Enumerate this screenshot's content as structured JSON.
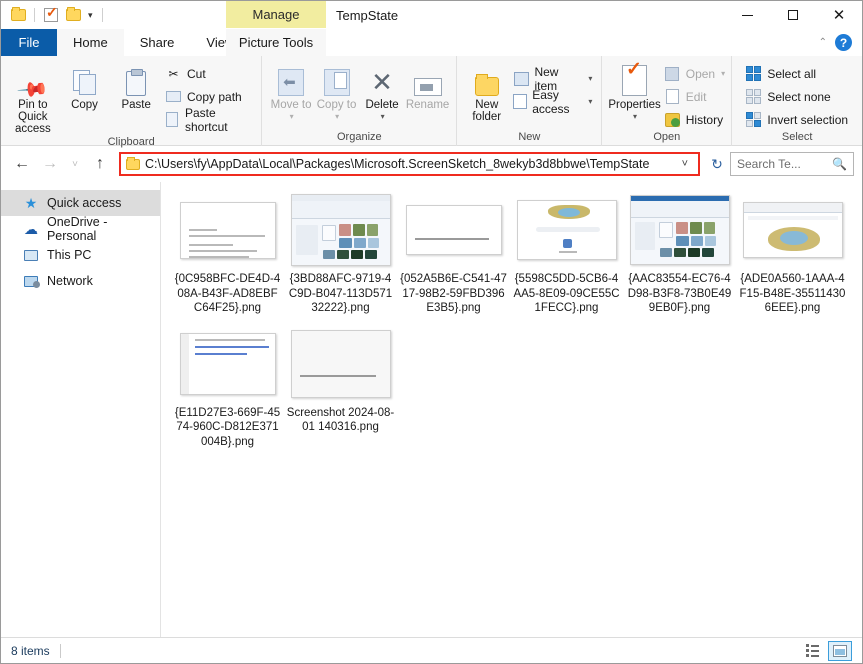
{
  "window": {
    "title": "TempState",
    "quick_access_toolbar": [
      {
        "name": "folder-properties",
        "icon": "folder-icon"
      },
      {
        "name": "checkbox-toggle",
        "icon": "checkbox-icon"
      },
      {
        "name": "new-folder-quick",
        "icon": "folder-icon"
      },
      {
        "name": "customize-qat",
        "icon": "chevron-down-icon"
      }
    ],
    "controls": {
      "minimize": "—",
      "maximize": "☐",
      "close": "✕"
    }
  },
  "contextual_tab": {
    "label": "Manage",
    "group": "Picture Tools",
    "color": "#f2eda0"
  },
  "tabs": [
    {
      "label": "File",
      "active": false,
      "accent": "#0b5ca8"
    },
    {
      "label": "Home",
      "active": true
    },
    {
      "label": "Share",
      "active": false
    },
    {
      "label": "View",
      "active": false
    },
    {
      "label": "Picture Tools",
      "active": false
    }
  ],
  "ribbon_right": {
    "collapse": "˄",
    "help": "?"
  },
  "ribbon": {
    "groups": [
      {
        "label": "Clipboard",
        "big_buttons": [
          {
            "label": "Pin to Quick access",
            "icon": "pin-icon",
            "disabled": false
          },
          {
            "label": "Copy",
            "icon": "copy-icon",
            "disabled": false
          },
          {
            "label": "Paste",
            "icon": "paste-icon",
            "disabled": false
          }
        ],
        "small_buttons": [
          {
            "label": "Cut",
            "icon": "scissors-icon",
            "disabled": false
          },
          {
            "label": "Copy path",
            "icon": "copy-path-icon",
            "disabled": false
          },
          {
            "label": "Paste shortcut",
            "icon": "paste-shortcut-icon",
            "disabled": false
          }
        ]
      },
      {
        "label": "Organize",
        "big_buttons": [
          {
            "label": "Move to",
            "icon": "move-to-icon",
            "disabled": true,
            "has_menu": true
          },
          {
            "label": "Copy to",
            "icon": "copy-to-icon",
            "disabled": true,
            "has_menu": true
          },
          {
            "label": "Delete",
            "icon": "delete-icon",
            "disabled": false,
            "has_menu": true
          },
          {
            "label": "Rename",
            "icon": "rename-icon",
            "disabled": true
          }
        ]
      },
      {
        "label": "New",
        "big_buttons": [
          {
            "label": "New folder",
            "icon": "new-folder-icon",
            "disabled": false
          }
        ],
        "small_buttons": [
          {
            "label": "New item",
            "icon": "new-item-icon",
            "has_menu": true
          },
          {
            "label": "Easy access",
            "icon": "easy-access-icon",
            "has_menu": true
          }
        ]
      },
      {
        "label": "Open",
        "big_buttons": [
          {
            "label": "Properties",
            "icon": "properties-icon",
            "disabled": false,
            "has_menu": true
          }
        ],
        "small_buttons": [
          {
            "label": "Open",
            "icon": "open-icon",
            "disabled": true,
            "has_menu": true
          },
          {
            "label": "Edit",
            "icon": "edit-icon",
            "disabled": true
          },
          {
            "label": "History",
            "icon": "history-icon",
            "disabled": false
          }
        ]
      },
      {
        "label": "Select",
        "small_buttons": [
          {
            "label": "Select all",
            "icon": "select-all-icon"
          },
          {
            "label": "Select none",
            "icon": "select-none-icon"
          },
          {
            "label": "Invert selection",
            "icon": "invert-selection-icon"
          }
        ]
      }
    ]
  },
  "address_bar": {
    "back": "←",
    "forward": "→",
    "recent": "˅",
    "up": "↑",
    "path": "C:\\Users\\fy\\AppData\\Local\\Packages\\Microsoft.ScreenSketch_8wekyb3d8bbwe\\TempState",
    "dropdown": "˅",
    "refresh": "↻",
    "highlight_color": "#ef2b1f"
  },
  "search": {
    "placeholder": "Search Te...",
    "value": "",
    "icon": "search-icon"
  },
  "sidebar": {
    "items": [
      {
        "label": "Quick access",
        "icon": "star-icon",
        "selected": true
      },
      {
        "label": "OneDrive - Personal",
        "icon": "cloud-icon",
        "selected": false
      },
      {
        "label": "This PC",
        "icon": "computer-icon",
        "selected": false
      },
      {
        "label": "Network",
        "icon": "network-icon",
        "selected": false
      }
    ]
  },
  "files": [
    {
      "name": "{0C958BFC-DE4D-408A-B43F-AD8EBFC64F25}.png",
      "thumb": "document"
    },
    {
      "name": "{3BD88AFC-9719-4C9D-B047-113D57132222}.png",
      "thumb": "explorer"
    },
    {
      "name": "{052A5B6E-C541-4717-98B2-59FBD396E3B5}.png",
      "thumb": "text-snip"
    },
    {
      "name": "{5598C5DD-5CB6-4AA5-8E09-09CE55C1FECC}.png",
      "thumb": "browser-home"
    },
    {
      "name": "{AAC83554-EC76-4D98-B3F8-73B0E499EB0F}.png",
      "thumb": "explorer"
    },
    {
      "name": "{ADE0A560-1AAA-4F15-B48E-355114306EEE}.png",
      "thumb": "browser-crest"
    },
    {
      "name": "{E11D27E3-669F-4574-960C-D812E371004B}.png",
      "thumb": "webpage"
    },
    {
      "name": "Screenshot 2024-08-01 140316.png",
      "thumb": "blank-snip"
    }
  ],
  "status_bar": {
    "item_count": "8 items",
    "views": [
      {
        "name": "details-view",
        "icon": "details-view-icon",
        "active": false
      },
      {
        "name": "large-icons-view",
        "icon": "large-icons-icon",
        "active": true
      }
    ]
  }
}
